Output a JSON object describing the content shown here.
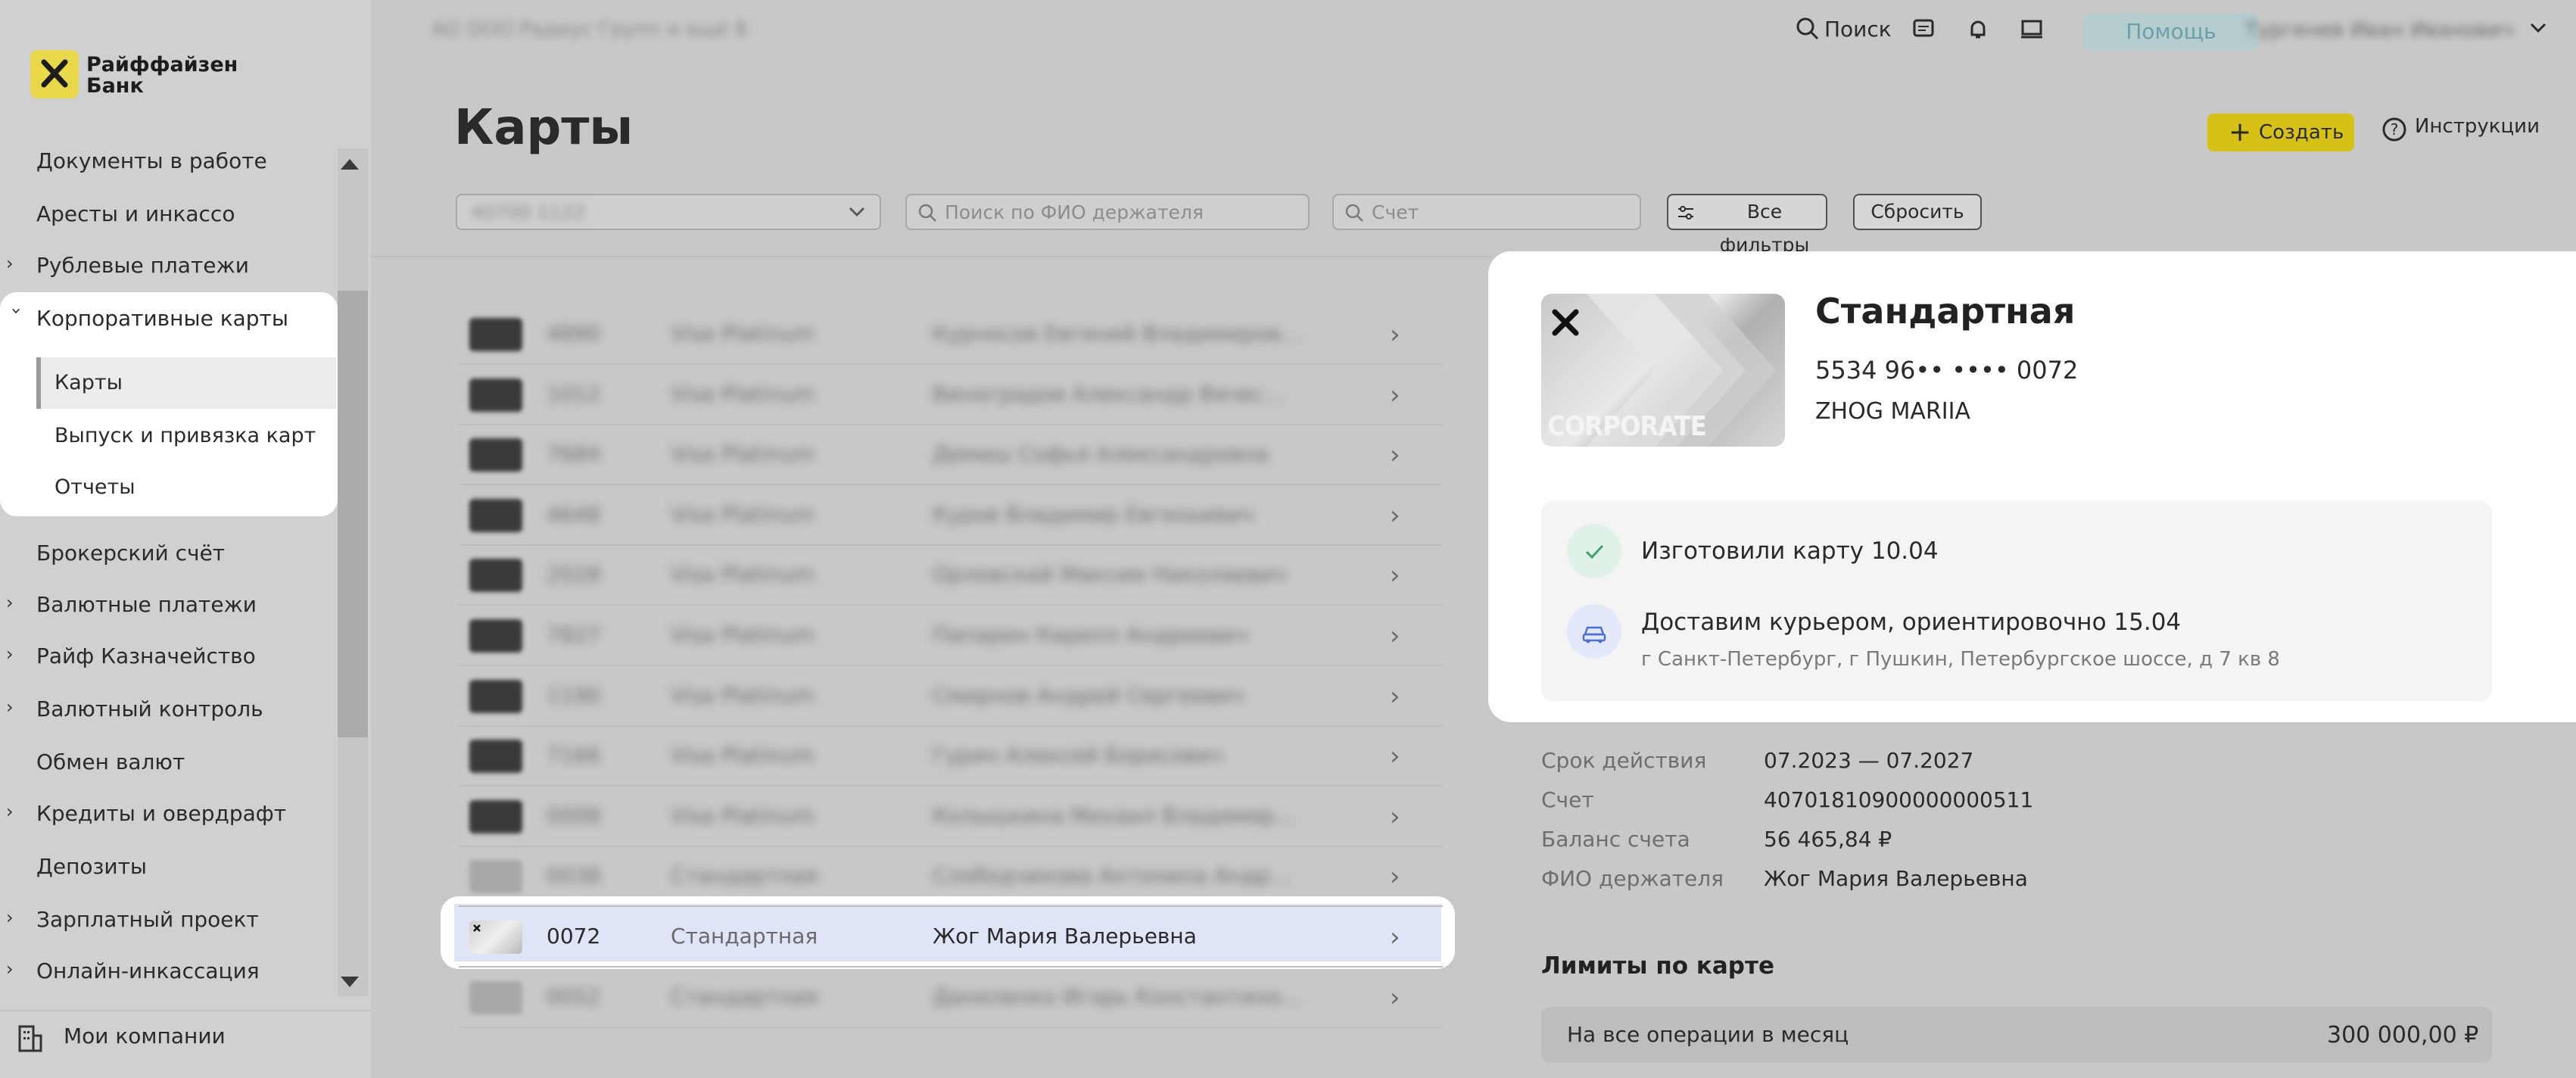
{
  "sidebar": {
    "logo_line1": "Райффайзен",
    "logo_line2": "Банк",
    "items": [
      {
        "label": "Документы в работе",
        "expandable": false
      },
      {
        "label": "Аресты и инкассо",
        "expandable": false
      },
      {
        "label": "Рублевые платежи",
        "expandable": true
      },
      {
        "label": "Корпоративные карты",
        "expandable": true,
        "expanded": true
      },
      {
        "label": "Брокерский счёт",
        "expandable": false
      },
      {
        "label": "Валютные платежи",
        "expandable": true
      },
      {
        "label": "Райф Казначейство",
        "expandable": true
      },
      {
        "label": "Валютный контроль",
        "expandable": true
      },
      {
        "label": "Обмен валют",
        "expandable": false
      },
      {
        "label": "Кредиты и овердрафт",
        "expandable": true
      },
      {
        "label": "Депозиты",
        "expandable": false
      },
      {
        "label": "Зарплатный проект",
        "expandable": true
      },
      {
        "label": "Онлайн-инкассация",
        "expandable": true
      }
    ],
    "sub_items": [
      "Карты",
      "Выпуск и привязка карт",
      "Отчеты"
    ],
    "active_sub_item": "Карты",
    "footer_label": "Мои компании"
  },
  "topbar": {
    "company": "АО ООО Радиус Групп и ещё 8",
    "search_label": "Поиск",
    "help_label": "Помощь",
    "user_name": "Тургенев Иван Иванович",
    "icons": [
      "search-icon",
      "chat-icon",
      "bell-icon",
      "monitor-icon",
      "chevron-down-icon"
    ]
  },
  "main": {
    "title": "Карты",
    "create_label": "Создать",
    "instructions_label": "Инструкции",
    "filters": {
      "account_select_value": "40700 1122",
      "holder_placeholder": "Поиск по ФИО держателя",
      "account_placeholder": "Счет",
      "all_filters_label": "Все фильтры",
      "reset_label": "Сбросить"
    },
    "rows": [
      {
        "num": "4890",
        "type": "Visa Platinum",
        "holder": "Курносов Евгений Владимиров...",
        "blurred": true
      },
      {
        "num": "1012",
        "type": "Visa Platinum",
        "holder": "Виноградов Александр Вячес...",
        "blurred": true
      },
      {
        "num": "7684",
        "type": "Visa Platinum",
        "holder": "Демиш Софья Александровна",
        "blurred": true
      },
      {
        "num": "4648",
        "type": "Visa Platinum",
        "holder": "Куров Владимир Евгеньевич",
        "blurred": true
      },
      {
        "num": "2028",
        "type": "Visa Platinum",
        "holder": "Орловский Максим Николаевич",
        "blurred": true
      },
      {
        "num": "7827",
        "type": "Visa Platinum",
        "holder": "Папарин Кирилл Андреевич",
        "blurred": true
      },
      {
        "num": "1190",
        "type": "Visa Platinum",
        "holder": "Смирнов Андрей Сергеевич",
        "blurred": true
      },
      {
        "num": "7166",
        "type": "Visa Platinum",
        "holder": "Гурин Алексей Борисович",
        "blurred": true
      },
      {
        "num": "0008",
        "type": "Visa Platinum",
        "holder": "Колышкина Михаил Владимир...",
        "blurred": true
      },
      {
        "num": "0038",
        "type": "Стандартная",
        "holder": "Слободчикова Антонина Андр...",
        "blurred": true
      },
      {
        "num": "0072",
        "type": "Стандартная",
        "holder": "Жог Мария Валерьевна",
        "blurred": false,
        "highlighted": true
      },
      {
        "num": "0052",
        "type": "Стандартная",
        "holder": "Даниленко Игорь Константино...",
        "blurred": true
      }
    ]
  },
  "detail": {
    "card_brand_text": "CORPORATE",
    "card_title": "Стандартная",
    "card_number": "5534 96•• •••• 0072",
    "card_holder": "ZHOG MARIIA",
    "status": [
      {
        "icon": "check-icon",
        "text": "Изготовили карту 10.04",
        "sub": ""
      },
      {
        "icon": "car-icon",
        "text": "Доставим курьером, ориентировочно 15.04",
        "sub": "г Санкт-Петербург, г Пушкин, Петербургское шоссе, д 7 кв 8"
      }
    ],
    "info": [
      {
        "label": "Срок действия",
        "value": "07.2023 — 07.2027"
      },
      {
        "label": "Счет",
        "value": "40701810900000000511"
      },
      {
        "label": "Баланс счета",
        "value": "56 465,84 ₽"
      },
      {
        "label": "ФИО держателя",
        "value": "Жог Мария Валерьевна"
      }
    ],
    "limits_title": "Лимиты по карте",
    "limits": [
      {
        "label": "На все операции в месяц",
        "value": "300 000,00 ₽"
      }
    ]
  },
  "colors": {
    "brand_yellow": "#fee600",
    "highlight_row": "#dfe4f7",
    "help_button": "#b6cdd0"
  }
}
